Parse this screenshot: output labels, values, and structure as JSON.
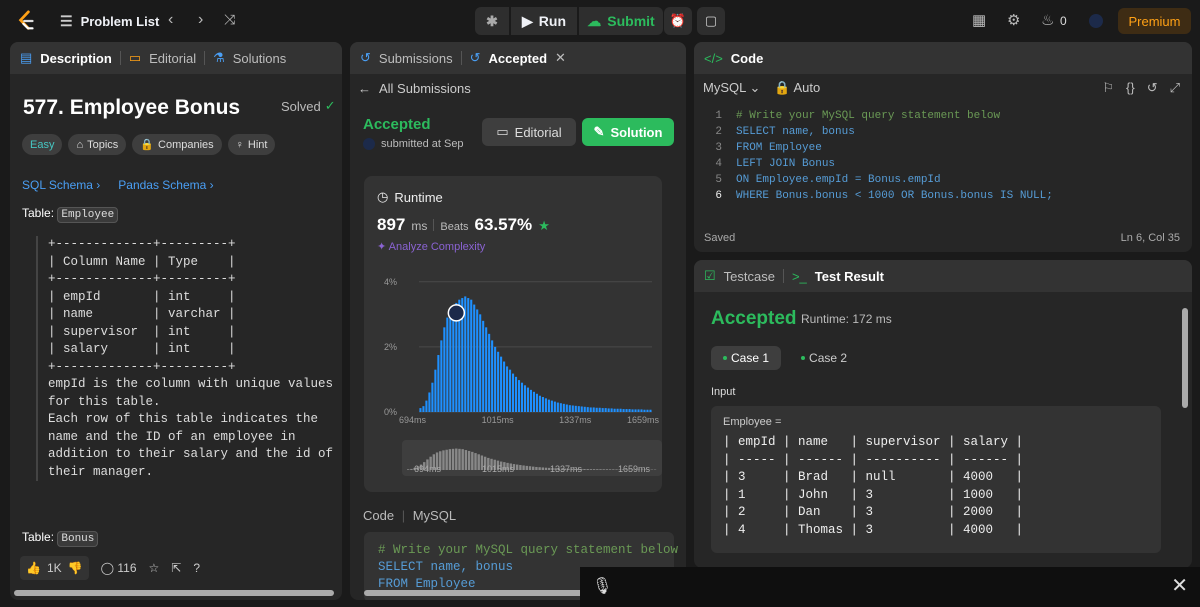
{
  "topbar": {
    "problem_list": "Problem List",
    "run": "Run",
    "submit": "Submit",
    "streak": "0",
    "premium": "Premium"
  },
  "description": {
    "tabs": [
      "Description",
      "Editorial",
      "Solutions"
    ],
    "title": "577. Employee Bonus",
    "solved": "Solved",
    "pills": [
      "Easy",
      "Topics",
      "Companies",
      "Hint"
    ],
    "links": [
      "SQL Schema",
      "Pandas Schema"
    ],
    "table_label": "Table:",
    "table_name": "Employee",
    "schema_text": "+-------------+---------+\n| Column Name | Type    |\n+-------------+---------+\n| empId       | int     |\n| name        | varchar |\n| supervisor  | int     |\n| salary      | int     |\n+-------------+---------+\nempId is the column with unique values\nfor this table.\nEach row of this table indicates the\nname and the ID of an employee in\naddition to their salary and the id of\ntheir manager.",
    "table2_name": "Bonus",
    "likes": "1K",
    "comments": "116"
  },
  "submissions": {
    "tab": "Submissions",
    "tab_active": "Accepted",
    "all_submissions": "All Submissions",
    "status": "Accepted",
    "submitted": "submitted at Sep",
    "editorial_btn": "Editorial",
    "solution_btn": "Solution",
    "runtime_label": "Runtime",
    "runtime_value": "897",
    "runtime_unit": "ms",
    "beats_label": "Beats",
    "beats_value": "63.57%",
    "analyze": "Analyze Complexity",
    "code_header": "Code",
    "code_lang": "MySQL",
    "code_preview": [
      "# Write your MySQL query statement below",
      "SELECT name, bonus",
      "FROM Employee"
    ]
  },
  "chart_data": {
    "type": "bar",
    "title": "",
    "xlabel": "",
    "ylabel": "",
    "x_ticks": [
      "694ms",
      "1015ms",
      "1337ms",
      "1659ms"
    ],
    "y_ticks": [
      "0%",
      "2%",
      "4%"
    ],
    "ylim": [
      0,
      4.3
    ],
    "x_range_ms": [
      694,
      1659
    ],
    "values": [
      0.12,
      0.18,
      0.35,
      0.6,
      0.9,
      1.3,
      1.75,
      2.2,
      2.6,
      2.9,
      3.1,
      3.25,
      3.35,
      3.45,
      3.5,
      3.55,
      3.5,
      3.45,
      3.3,
      3.15,
      3.0,
      2.8,
      2.6,
      2.4,
      2.2,
      2.0,
      1.85,
      1.7,
      1.55,
      1.4,
      1.3,
      1.18,
      1.08,
      0.98,
      0.9,
      0.82,
      0.75,
      0.68,
      0.62,
      0.56,
      0.5,
      0.46,
      0.42,
      0.38,
      0.35,
      0.32,
      0.29,
      0.27,
      0.25,
      0.23,
      0.21,
      0.2,
      0.19,
      0.18,
      0.17,
      0.16,
      0.15,
      0.14,
      0.14,
      0.13,
      0.13,
      0.12,
      0.12,
      0.11,
      0.11,
      0.1,
      0.1,
      0.1,
      0.09,
      0.09,
      0.09,
      0.08,
      0.08,
      0.08,
      0.08,
      0.07,
      0.07,
      0.07
    ],
    "marker_index": 12,
    "bar_color": "#1e90ff"
  },
  "code": {
    "title": "Code",
    "lang": "MySQL",
    "mode": "Auto",
    "lines": [
      "# Write your MySQL query statement below",
      "SELECT name, bonus",
      "FROM Employee",
      "LEFT JOIN Bonus",
      "ON Employee.empId = Bonus.empId",
      "WHERE Bonus.bonus < 1000 OR Bonus.bonus IS NULL;"
    ],
    "saved": "Saved",
    "position": "Ln 6, Col 35"
  },
  "test": {
    "tab1": "Testcase",
    "tab2": "Test Result",
    "status": "Accepted",
    "runtime": "Runtime: 172 ms",
    "cases": [
      "Case 1",
      "Case 2"
    ],
    "input_label": "Input",
    "var_label": "Employee =",
    "table": "| empId | name   | supervisor | salary |\n| ----- | ------ | ---------- | ------ |\n| 3     | Brad   | null       | 4000   |\n| 1     | John   | 3          | 1000   |\n| 2     | Dan    | 3          | 2000   |\n| 4     | Thomas | 3          | 4000   |"
  }
}
